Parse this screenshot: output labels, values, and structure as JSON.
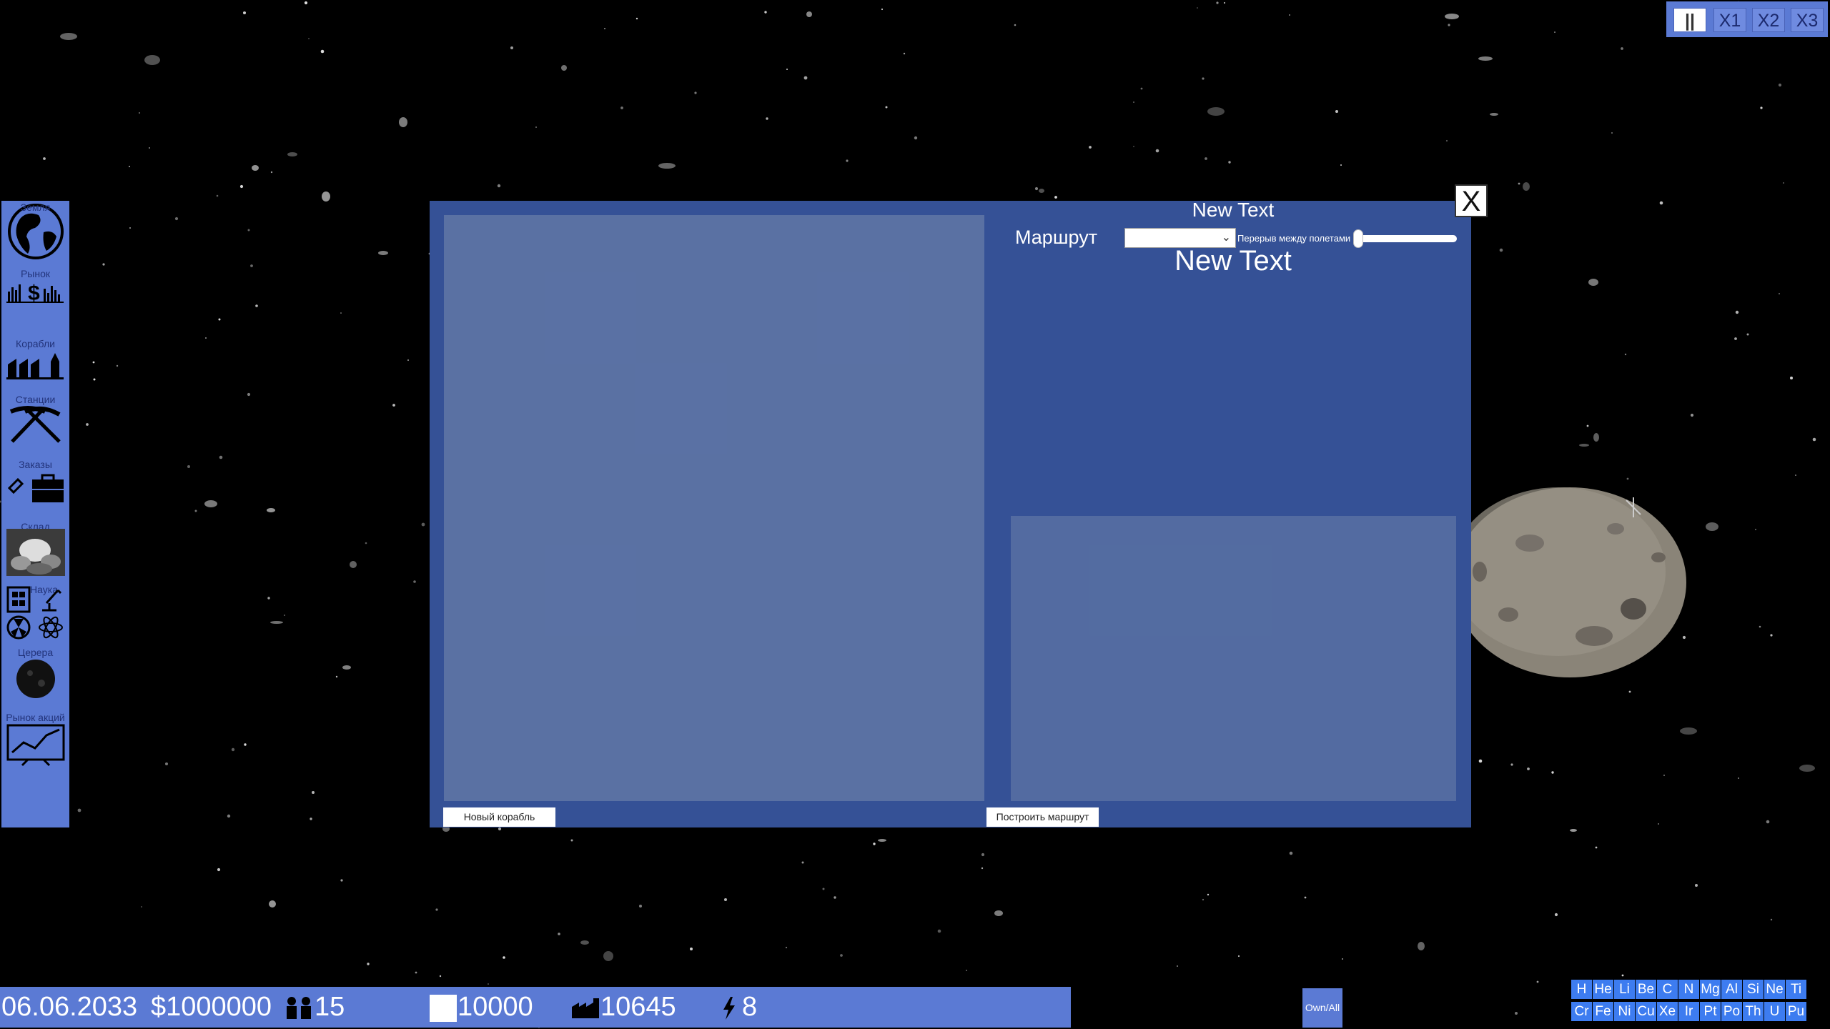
{
  "sidebar": {
    "items": [
      {
        "label": "Земля",
        "icon": "globe-icon"
      },
      {
        "label": "Рынок",
        "icon": "market-icon"
      },
      {
        "label": "Корабли",
        "icon": "ships-icon"
      },
      {
        "label": "Станции",
        "icon": "pickaxe-icon"
      },
      {
        "label": "Заказы",
        "icon": "briefcase-icon"
      },
      {
        "label": "Склад",
        "icon": "warehouse-icon"
      },
      {
        "label": "Наука",
        "icon": "science-icon"
      },
      {
        "label": "Церера",
        "icon": "ceres-icon"
      },
      {
        "label": "Рынок акций",
        "icon": "stock-chart-icon"
      }
    ]
  },
  "speed": {
    "pause": "||",
    "x1": "X1",
    "x2": "X2",
    "x3": "X3"
  },
  "modal": {
    "close": "X",
    "title_small": "New Text",
    "title_big": "New Text",
    "route_label": "Маршрут",
    "route_value": "",
    "interval_label": "Перерыв между полетами",
    "interval_value": 0,
    "new_ship_button": "Новый корабль",
    "build_route_button": "Построить маршрут"
  },
  "status": {
    "date": "06.06.2033",
    "money": "$1000000",
    "population": "15",
    "storage": "10000",
    "ships": "10645",
    "energy": "8"
  },
  "own_all": "Own/All",
  "elements": {
    "row1": [
      "H",
      "He",
      "Li",
      "Be",
      "C",
      "N",
      "Mg",
      "Al",
      "Si",
      "Ne",
      "Ti"
    ],
    "row2": [
      "Cr",
      "Fe",
      "Ni",
      "Cu",
      "Xe",
      "Ir",
      "Pt",
      "Po",
      "Th",
      "U",
      "Pu"
    ]
  },
  "colors": {
    "panel_blue": "#5b7ad4",
    "modal_blue": "#355196",
    "element_blue": "#3d7cf0"
  }
}
